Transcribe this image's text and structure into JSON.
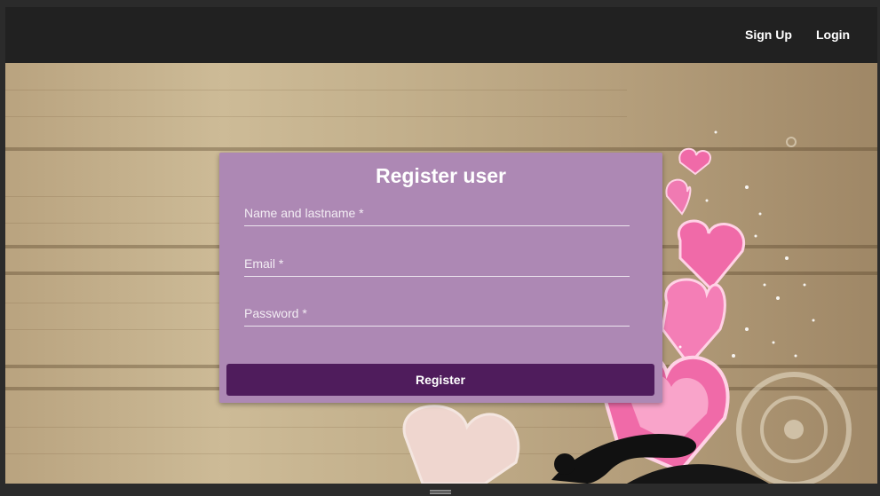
{
  "nav": {
    "signup_label": "Sign Up",
    "login_label": "Login"
  },
  "form": {
    "title": "Register user",
    "name_placeholder": "Name and lastname *",
    "email_placeholder": "Email *",
    "password_placeholder": "Password *",
    "submit_label": "Register"
  },
  "colors": {
    "topbar": "#212121",
    "card": "#ad88b4",
    "button": "#4f1c5c",
    "heart_pink": "#f06aa8"
  }
}
